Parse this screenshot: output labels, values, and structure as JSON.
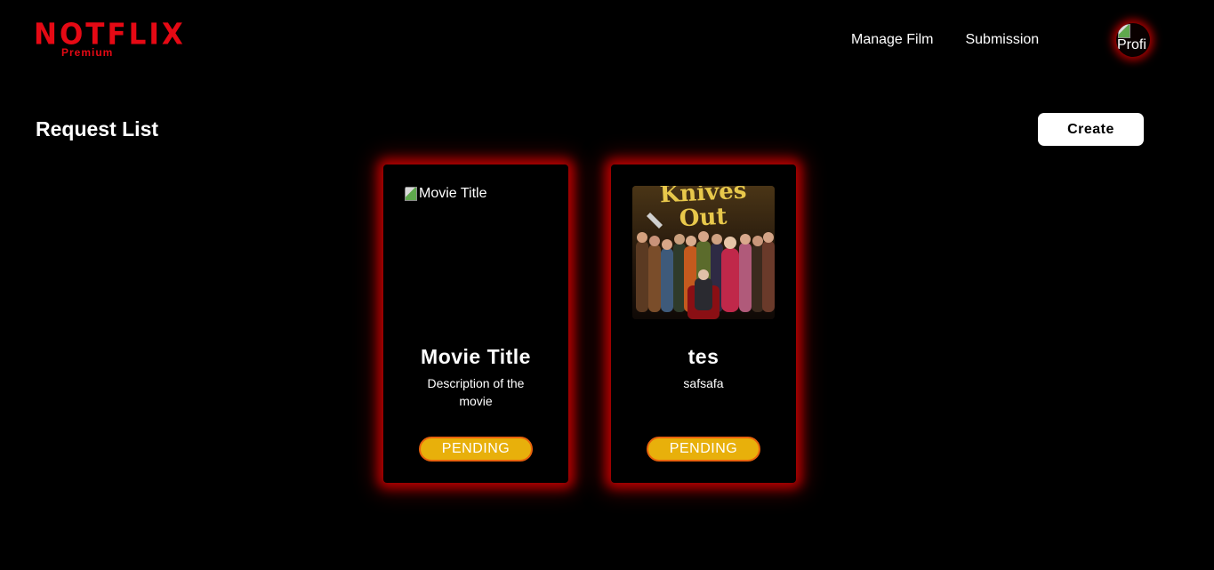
{
  "brand": {
    "name": "NOTFLIX",
    "tier": "Premium",
    "color": "#e50914"
  },
  "nav": {
    "items": [
      {
        "label": "Manage Film"
      },
      {
        "label": "Submission"
      }
    ],
    "avatar_alt": "Profi"
  },
  "page": {
    "title": "Request List",
    "create_label": "Create"
  },
  "cards": [
    {
      "poster_alt": "Movie Title",
      "poster_loaded": false,
      "title": "Movie Title",
      "description": "Description of the movie",
      "status": "PENDING"
    },
    {
      "poster_loaded": true,
      "title": "tes",
      "description": "safsafa",
      "status": "PENDING"
    }
  ],
  "colors": {
    "background": "#000000",
    "card_glow": "#c80000",
    "badge_fill": "#e8b00b",
    "badge_border": "#e8620c"
  }
}
